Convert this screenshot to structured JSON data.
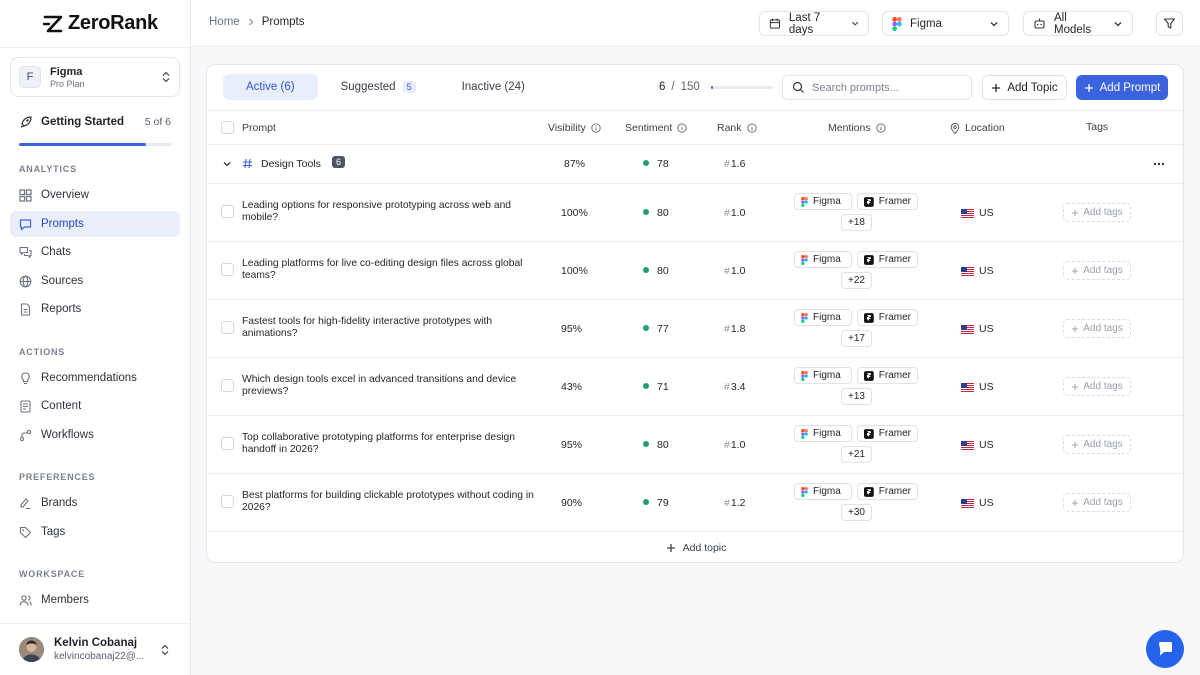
{
  "app": {
    "logo": "ZeroRank"
  },
  "org": {
    "initial": "F",
    "name": "Figma",
    "plan": "Pro Plan"
  },
  "getting_started": {
    "label": "Getting Started",
    "progress_text": "5 of 6",
    "progress": 0.8333
  },
  "nav": {
    "analytics_label": "ANALYTICS",
    "analytics": [
      {
        "label": "Overview",
        "icon": "grid-icon"
      },
      {
        "label": "Prompts",
        "icon": "message-icon",
        "active": true
      },
      {
        "label": "Chats",
        "icon": "chats-icon"
      },
      {
        "label": "Sources",
        "icon": "globe-icon"
      },
      {
        "label": "Reports",
        "icon": "file-icon"
      }
    ],
    "actions_label": "ACTIONS",
    "actions": [
      {
        "label": "Recommendations",
        "icon": "lightbulb-icon"
      },
      {
        "label": "Content",
        "icon": "document-icon"
      },
      {
        "label": "Workflows",
        "icon": "workflow-icon"
      }
    ],
    "preferences_label": "PREFERENCES",
    "preferences": [
      {
        "label": "Brands",
        "icon": "brand-icon"
      },
      {
        "label": "Tags",
        "icon": "tag-icon"
      }
    ],
    "workspace_label": "WORKSPACE",
    "workspace": [
      {
        "label": "Members",
        "icon": "users-icon"
      }
    ]
  },
  "user": {
    "name": "Kelvin Cobanaj",
    "email": "kelvincobanaj22@..."
  },
  "topbar": {
    "breadcrumb_home": "Home",
    "breadcrumb_current": "Prompts",
    "date_range": "Last 7 days",
    "brand": "Figma",
    "models": "All Models"
  },
  "tabs": {
    "active": "Active (6)",
    "suggested": "Suggested",
    "suggested_count": "5",
    "inactive": "Inactive (24)"
  },
  "counter": {
    "used": "6",
    "sep": "/",
    "limit": "150",
    "fraction": 0.04
  },
  "search": {
    "placeholder": "Search prompts..."
  },
  "buttons": {
    "add_topic": "Add Topic",
    "add_prompt": "Add Prompt",
    "add_tags": "Add tags",
    "add_topic_footer": "Add topic"
  },
  "columns": {
    "prompt": "Prompt",
    "visibility": "Visibility",
    "sentiment": "Sentiment",
    "rank": "Rank",
    "mentions": "Mentions",
    "location": "Location",
    "tags": "Tags"
  },
  "group": {
    "name": "Design Tools",
    "count": "6",
    "visibility": "87%",
    "sentiment": "78",
    "rank": "1.6"
  },
  "rows": [
    {
      "prompt": "Leading options for responsive prototyping across web and mobile?",
      "visibility": "100%",
      "sentiment": "80",
      "rank": "1.0",
      "mention_a": "Figma",
      "mention_b": "Framer",
      "more": "+18",
      "location": "US"
    },
    {
      "prompt": "Leading platforms for live co-editing design files across global teams?",
      "visibility": "100%",
      "sentiment": "80",
      "rank": "1.0",
      "mention_a": "Figma",
      "mention_b": "Framer",
      "more": "+22",
      "location": "US"
    },
    {
      "prompt": "Fastest tools for high-fidelity interactive prototypes with animations?",
      "visibility": "95%",
      "sentiment": "77",
      "rank": "1.8",
      "mention_a": "Figma",
      "mention_b": "Framer",
      "more": "+17",
      "location": "US"
    },
    {
      "prompt": "Which design tools excel in advanced transitions and device previews?",
      "visibility": "43%",
      "sentiment": "71",
      "rank": "3.4",
      "mention_a": "Figma",
      "mention_b": "Framer",
      "more": "+13",
      "location": "US"
    },
    {
      "prompt": "Top collaborative prototyping platforms for enterprise design handoff in 2026?",
      "visibility": "95%",
      "sentiment": "80",
      "rank": "1.0",
      "mention_a": "Figma",
      "mention_b": "Framer",
      "more": "+21",
      "location": "US"
    },
    {
      "prompt": "Best platforms for building clickable prototypes without coding in 2026?",
      "visibility": "90%",
      "sentiment": "79",
      "rank": "1.2",
      "mention_a": "Figma",
      "mention_b": "Framer",
      "more": "+30",
      "location": "US"
    }
  ],
  "colors": {
    "accent": "#3b63e0",
    "positive": "#22a06b",
    "chat_button": "#2563eb"
  }
}
